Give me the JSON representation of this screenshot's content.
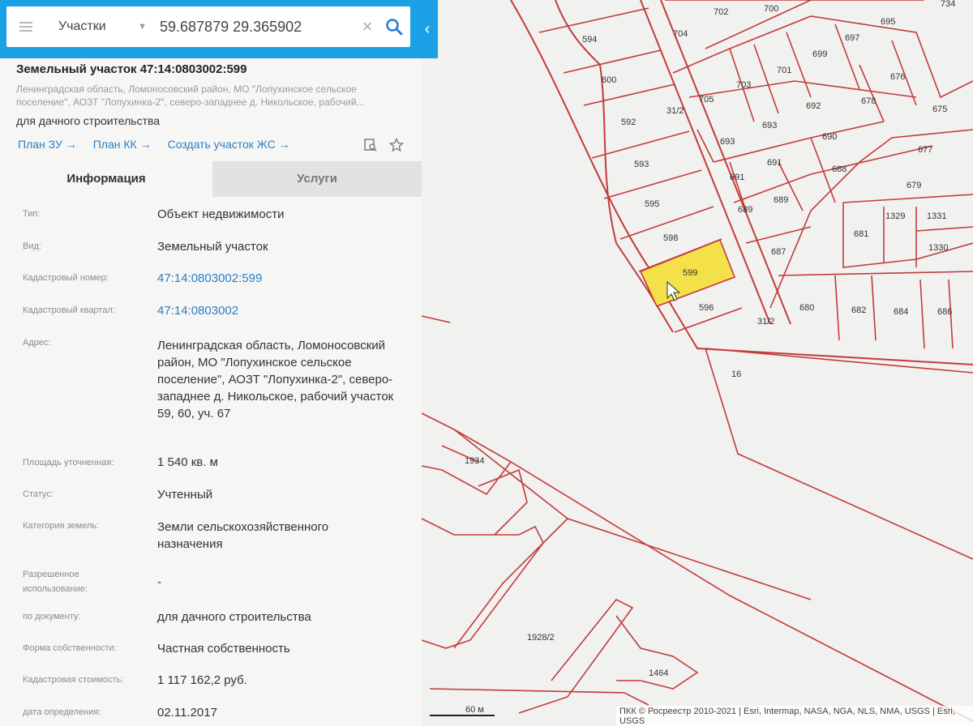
{
  "search": {
    "layer_label": "Участки",
    "query_value": "59.687879 29.365902",
    "clear_glyph": "×"
  },
  "parcel": {
    "title": "Земельный участок 47:14:0803002:599",
    "address_short": "Ленинградская область, Ломоносовский район, МО \"Лопухинское сельское поселение\", АОЗТ \"Лопухинка-2\", северо-западнее д. Никольское, рабочий...",
    "use": "для дачного строительства",
    "links": [
      "План ЗУ →",
      "План КК →",
      "Создать участок ЖС →"
    ]
  },
  "tabs": {
    "info": "Информация",
    "services": "Услуги"
  },
  "details": [
    {
      "label": "Тип:",
      "value": "Объект недвижимости",
      "link": false
    },
    {
      "label": "Вид:",
      "value": "Земельный участок",
      "link": false
    },
    {
      "label": "Кадастровый номер:",
      "value": "47:14:0803002:599",
      "link": true
    },
    {
      "label": "Кадастровый квартал:",
      "value": "47:14:0803002",
      "link": true
    },
    {
      "label": "Адрес:",
      "value": "Ленинградская область, Ломоносовский район, МО \"Лопухинское сельское поселение\", АОЗТ \"Лопухинка-2\", северо-западнее д. Никольское, рабочий участок 59, 60, уч. 67",
      "link": false
    },
    {
      "label": "Площадь уточненная:",
      "value": "1 540 кв. м",
      "link": false
    },
    {
      "label": "Статус:",
      "value": "Учтенный",
      "link": false
    },
    {
      "label": "Категория земель:",
      "value": "Земли сельскохозяйственного назначения",
      "link": false
    },
    {
      "label": "Разрешенное использование:",
      "value": "-",
      "link": false
    },
    {
      "label": "по документу:",
      "value": "для дачного строительства",
      "link": false
    },
    {
      "label": "Форма собственности:",
      "value": "Частная собственность",
      "link": false
    },
    {
      "label": "Кадастровая стоимость:",
      "value": "1 117 162,2 руб.",
      "link": false
    },
    {
      "label": "дата определения:",
      "value": "02.11.2017",
      "link": false
    }
  ],
  "map": {
    "parcel_labels": [
      "594",
      "600",
      "592",
      "593",
      "595",
      "598",
      "599",
      "596",
      "704",
      "702",
      "700",
      "705",
      "703",
      "701",
      "699",
      "697",
      "695",
      "693",
      "693",
      "691",
      "691",
      "692",
      "690",
      "688",
      "689",
      "689",
      "687",
      "676",
      "678",
      "675",
      "677",
      "679",
      "681",
      "1329",
      "1331",
      "1330",
      "680",
      "682",
      "684",
      "686",
      "16",
      "1934",
      "1928/2",
      "1464",
      "734",
      "31/2",
      "31/2"
    ],
    "scale_label": "60 м",
    "credits": "ПКК © Росреестр 2010-2021 | Esri, Intermap, NASA, NGA, NLS, NMA, USGS | Esri, USGS",
    "highlight_color": "#f4e14a",
    "boundary_color": "#c33b3b",
    "accent_color": "#1da1e6"
  },
  "icons": [
    "menu-icon",
    "chevron-down-icon",
    "close-icon",
    "search-icon",
    "collapse-left-icon",
    "zoom-to-icon",
    "star-icon",
    "cursor-icon"
  ]
}
